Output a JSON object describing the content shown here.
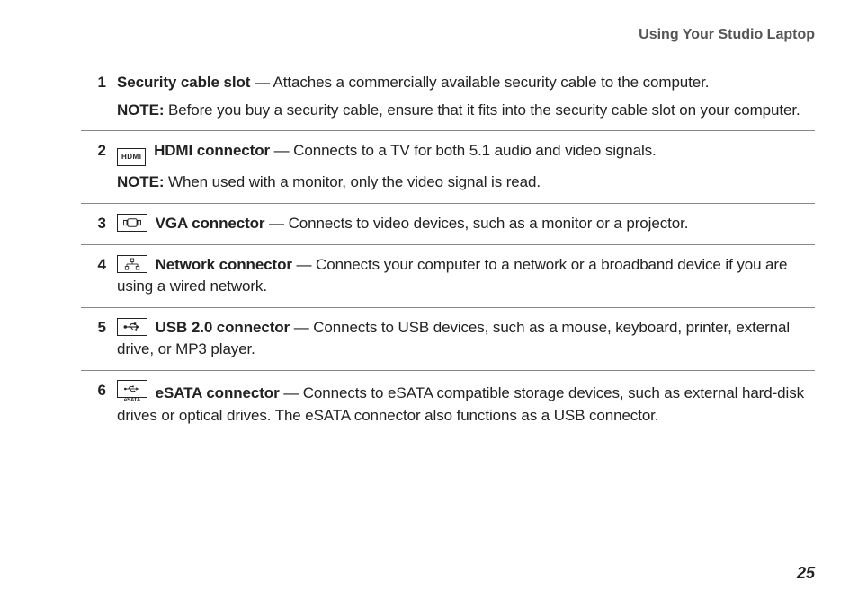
{
  "header": {
    "title": "Using Your Studio Laptop"
  },
  "items": [
    {
      "num": "1",
      "icon": null,
      "title": "Security cable slot",
      "desc": " — Attaches a commercially available security cable to the computer.",
      "note_label": "NOTE:",
      "note": " Before you buy a security cable, ensure that it fits into the security cable slot on your computer."
    },
    {
      "num": "2",
      "icon": "hdmi",
      "icon_text": "HDMI",
      "title": "HDMI connector",
      "desc": " — Connects to a TV for both 5.1 audio and video signals.",
      "note_label": "NOTE:",
      "note": " When used with a monitor, only the video signal is read."
    },
    {
      "num": "3",
      "icon": "vga",
      "title": "VGA connector",
      "desc": " — Connects to video devices, such as a monitor or a projector.",
      "note_label": null,
      "note": null
    },
    {
      "num": "4",
      "icon": "network",
      "title": "Network connector",
      "desc": " — Connects your computer to a network or a broadband device if you are using a wired network.",
      "note_label": null,
      "note": null
    },
    {
      "num": "5",
      "icon": "usb",
      "title": "USB 2.0 connector",
      "desc": " — Connects to USB devices, such as a mouse, keyboard, printer, external drive, or MP3 player.",
      "note_label": null,
      "note": null
    },
    {
      "num": "6",
      "icon": "esata",
      "icon_text": "eSATA",
      "title": "eSATA connector",
      "desc": " — Connects to eSATA compatible storage devices, such as external hard-disk drives or optical drives. The eSATA connector also functions as a USB connector.",
      "note_label": null,
      "note": null
    }
  ],
  "page_number": "25"
}
